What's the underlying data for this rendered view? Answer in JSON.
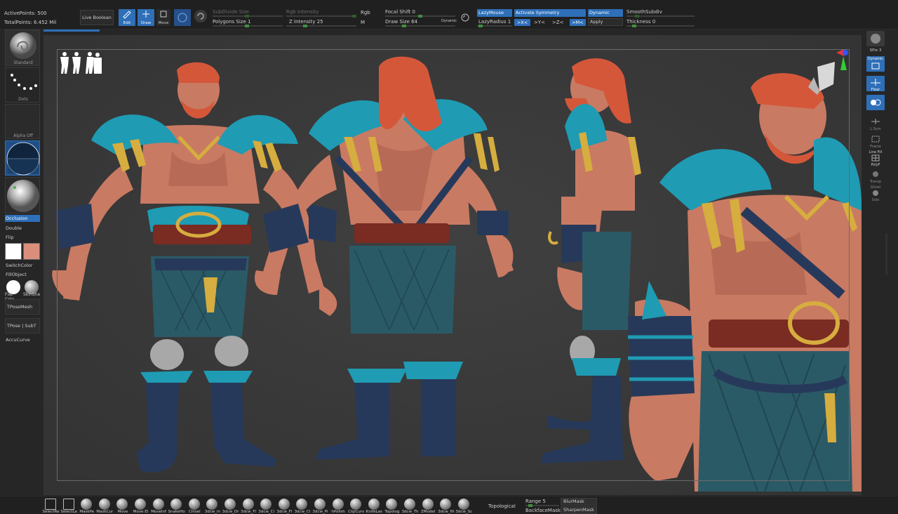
{
  "stats": {
    "active_points": "ActivePoints: 500",
    "total_points": "TotalPoints: 6.452 Mil"
  },
  "toolbar": {
    "live_boolean": "Live Boolean",
    "edit": "Edit",
    "draw": "Draw",
    "move": "Move",
    "subdivide_size": "SubDivide Size",
    "polygons_size": "Polygons Size 1",
    "rgb_intensity": "Rgb Intensity",
    "z_intensity": "Z Intensity 25",
    "rgb": "Rgb",
    "m": "M",
    "focal_shift": "Focal Shift 0",
    "draw_size": "Draw Size 64",
    "dynamic_small": "Dynamic",
    "lazy_mouse": "LazyMouse",
    "lazy_radius": "LazyRadius 1",
    "activate_symmetry": "Activate Symmetry",
    "axis_x": ">X<",
    "axis_y": ">Y<",
    "axis_z": ">Z<",
    "axis_m": ">M<",
    "dynamic": "Dynamic",
    "apply": "Apply",
    "smooth_subdiv": "SmoothSubdiv",
    "thickness": "Thickness 0"
  },
  "left": {
    "brush_label": "Standard",
    "stroke_label": "Dots",
    "alpha_label": "Alpha Off",
    "occlusion": "Occlusion",
    "double": "Double",
    "flip": "Flip",
    "switch_color": "SwitchColor",
    "fill_object": "FillObject",
    "flat_color": "Flat Colo",
    "skin_shade": "SkinSha",
    "tpose_mesh": "TPoseMesh",
    "tpose_subt": "TPose | SubT",
    "accucurve": "AccuCurve"
  },
  "right": {
    "spix": "SPix 3",
    "dynamic_persp": "Dynamic",
    "persp": "Persp",
    "floor": "Floor",
    "lsym": "L.Sym",
    "frame": "Frame",
    "line_fill": "Line Fill",
    "polyf": "PolyF",
    "transp": "Transp",
    "ghost": "Ghost",
    "solo": "Solo"
  },
  "colors": {
    "accent": "#2e6fb8",
    "primary_swatch": "#ffffff",
    "secondary_swatch": "#d98f7b",
    "feather": "#1f9bb3",
    "skin": "#c97a63",
    "hair": "#d4573a",
    "gold": "#d6ad3f",
    "leather": "#27395a"
  },
  "bottom": {
    "brushes": [
      "SelectRe",
      "SelectLa",
      "MaskPe",
      "MaskCur",
      "Move",
      "Move El",
      "MoveInf",
      "SnakeHo",
      "Chisel",
      "3dcw_in",
      "3dcw_Dr",
      "3dcw_Fl",
      "3dcw_Cl",
      "3dcw_Fl",
      "3dcw_Cl",
      "3dcw_Pi",
      "hPolish",
      "ClipCurv",
      "KnifeLas",
      "Topolog",
      "3dcw_Th",
      "ZModel",
      "3dcw_Hi",
      "3dcw_Sc"
    ],
    "topological": "Topological",
    "range": "Range 5",
    "backface_mask": "BackfaceMask",
    "blur_mask": "BlurMask",
    "sharpen_mask": "SharpenMask"
  }
}
